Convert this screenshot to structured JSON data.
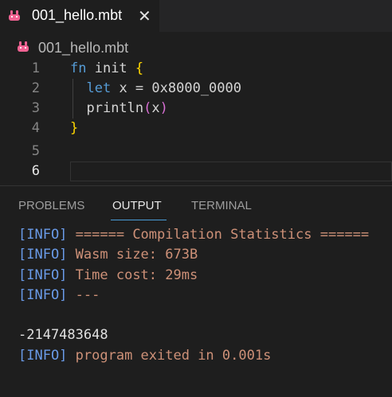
{
  "tab": {
    "label": "001_hello.mbt",
    "close": "✕"
  },
  "breadcrumb": {
    "label": "001_hello.mbt"
  },
  "editor": {
    "line_numbers": [
      "1",
      "2",
      "3",
      "4",
      "5",
      "6"
    ],
    "tokens": {
      "l1_kw": "fn",
      "l1_name": " init ",
      "l1_brace": "{",
      "l2_kw": "let",
      "l2_var": " x ",
      "l2_eq": "= ",
      "l2_num": "0x8000_0000",
      "l3_fn": "println",
      "l3_open": "(",
      "l3_arg": "x",
      "l3_close": ")",
      "l4_brace": "}"
    }
  },
  "panel": {
    "tabs": [
      "PROBLEMS",
      "OUTPUT",
      "TERMINAL"
    ],
    "active_tab": "OUTPUT"
  },
  "output": {
    "tag": "[INFO]",
    "lines": [
      "====== Compilation Statistics ======",
      "Wasm size: 673B",
      "Time cost: 29ms",
      "---"
    ],
    "result": "-2147483648",
    "exit_msg": "program exited in 0.001s"
  },
  "colors": {
    "accent": "#4a9dd8",
    "info_tag": "#6a9be8",
    "message": "#ce9178"
  },
  "icons": {
    "file_icon": "moonbit-rabbit-icon"
  }
}
